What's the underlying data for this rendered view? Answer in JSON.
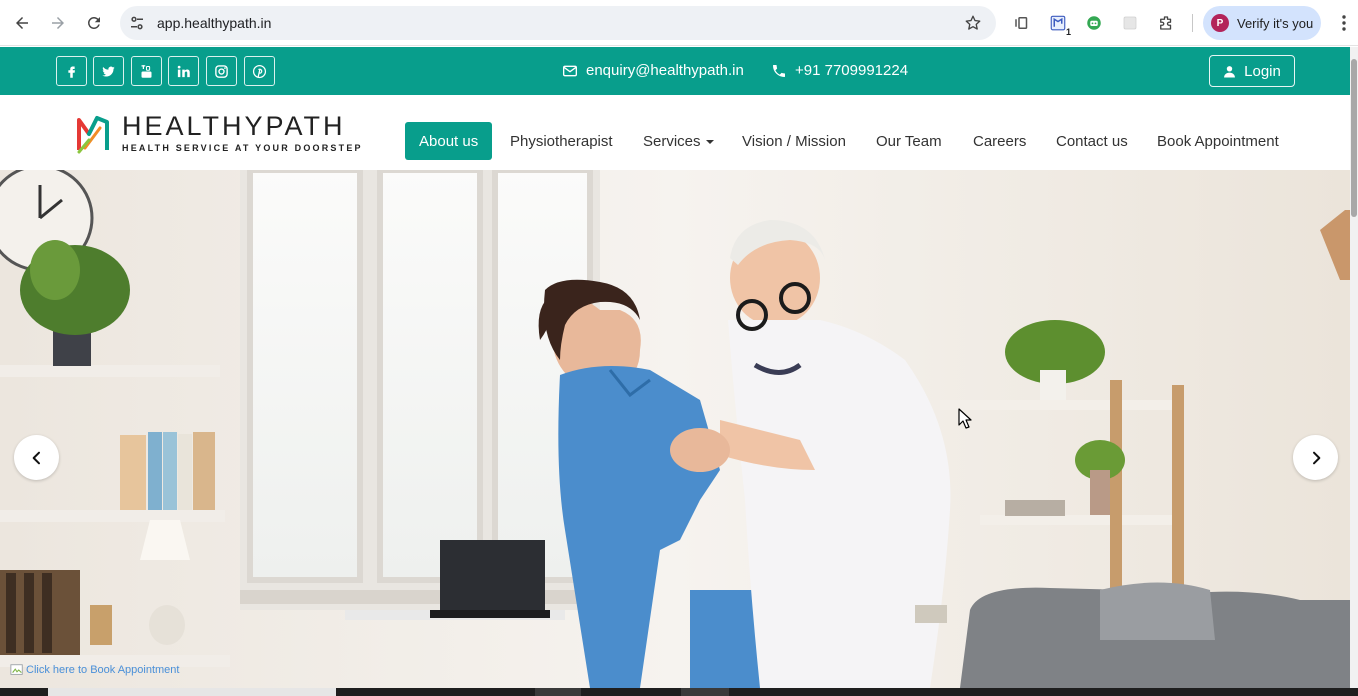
{
  "browser": {
    "url": "app.healthypath.in",
    "profile_initial": "P",
    "profile_label": "Verify it's you",
    "extension_badge": "1"
  },
  "topbar": {
    "email": "enquiry@healthypath.in",
    "phone": "+91 7709991224",
    "login_label": "Login",
    "socials": [
      "facebook",
      "twitter",
      "youtube",
      "linkedin",
      "instagram",
      "pinterest"
    ]
  },
  "brand": {
    "name": "HEALTHYPATH",
    "tagline": "HEALTH SERVICE AT YOUR DOORSTEP"
  },
  "menu": {
    "about": "About us",
    "physio": "Physiotherapist",
    "services": "Services",
    "vision": "Vision / Mission",
    "team": "Our Team",
    "careers": "Careers",
    "contact": "Contact us",
    "book": "Book Appointment"
  },
  "hero": {
    "book_link": "Click here to Book Appointment"
  },
  "colors": {
    "brand_teal": "#089e8c"
  }
}
